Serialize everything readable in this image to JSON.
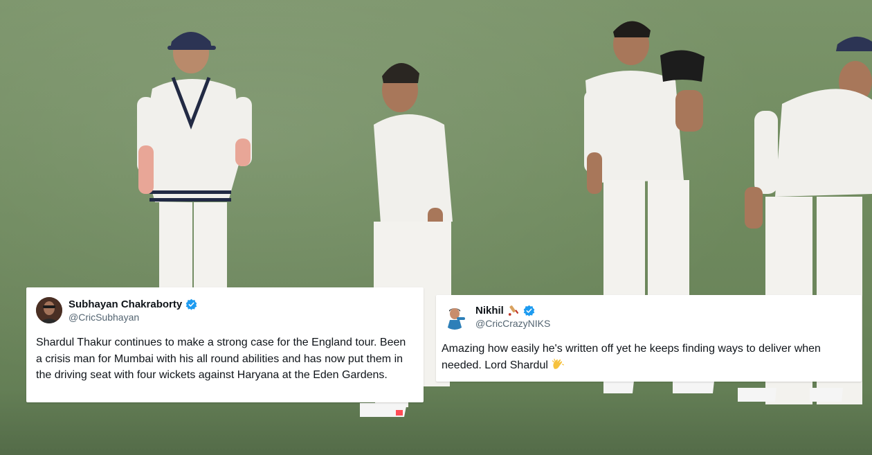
{
  "tweets": [
    {
      "name": "Subhayan Chakraborty",
      "handle": "@CricSubhayan",
      "verified": true,
      "avatar_icon": "profile-photo-avatar",
      "text": "Shardul Thakur continues to make a strong case for the England tour. Been a crisis man for Mumbai with his all round abilities and has now put them in the driving seat with four wickets against Haryana at the Eden Gardens."
    },
    {
      "name": "Nikhil",
      "name_emoji": "cricket-bat-icon",
      "handle": "@CricCrazyNIKS",
      "verified": true,
      "avatar_icon": "cartoon-avatar",
      "text": "Amazing how easily he's written off yet he keeps finding ways to deliver when needed. Lord Shardul",
      "text_emoji": "clapping-hands-icon"
    }
  ],
  "colors": {
    "verified_badge": "#1d9bf0",
    "text_primary": "#0f1419",
    "text_secondary": "#536471",
    "pitch_green": "#6f8a5e"
  }
}
